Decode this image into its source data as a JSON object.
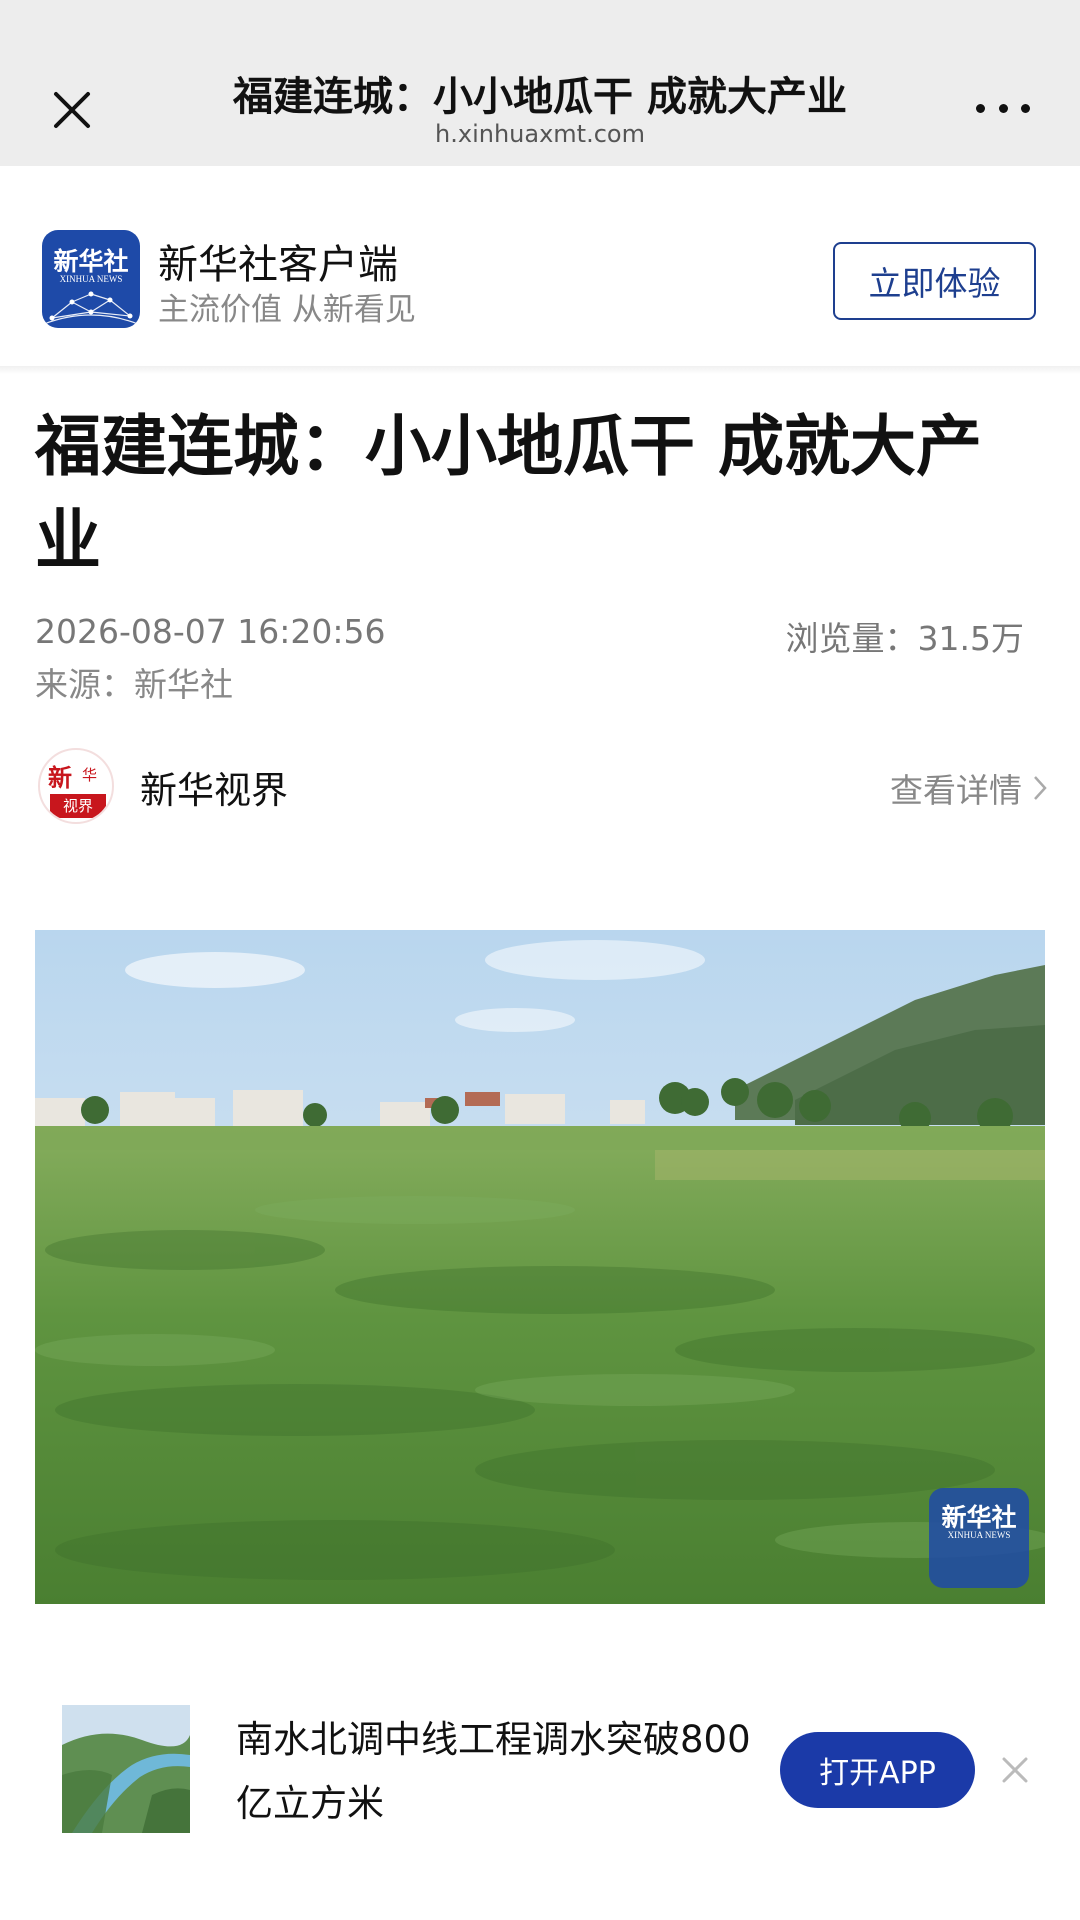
{
  "browser": {
    "title": "福建连城：小小地瓜干 成就大产业",
    "url": "h.xinhuaxmt.com",
    "close_icon": "close-icon",
    "more_icon": "more-dots-icon"
  },
  "app_banner": {
    "logo_text_cn": "新华社",
    "logo_text_en": "XINHUA NEWS",
    "name": "新华社客户端",
    "slogan": "主流价值 从新看见",
    "try_label": "立即体验",
    "accent_color": "#1e3f8f"
  },
  "article": {
    "title": "福建连城：小小地瓜干 成就大产业",
    "date": "2026-08-07 16:20:56",
    "views": "浏览量：31.5万",
    "source": "来源：新华社"
  },
  "account": {
    "logo_text_1": "新",
    "logo_text_2": "华",
    "logo_text_3": "视界",
    "name": "新华视界",
    "detail_label": "查看详情",
    "brand_color": "#c8161d"
  },
  "photo": {
    "watermark_cn": "新华社",
    "watermark_en": "XINHUA NEWS"
  },
  "promo": {
    "text": "南水北调中线工程调水突破800亿立方米",
    "open_label": "打开APP",
    "button_color": "#1b3aa8"
  }
}
